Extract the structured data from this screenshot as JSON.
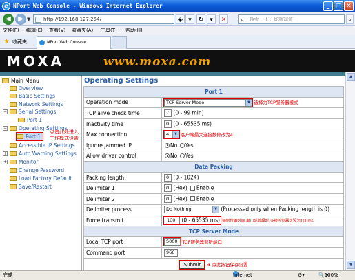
{
  "window": {
    "title": "NPort Web Console - Windows Internet Explorer",
    "buttons": [
      "_",
      "□",
      "✕"
    ]
  },
  "nav": {
    "address": "http://192.168.127.254/",
    "search_placeholder": "搜索一下，你就知道"
  },
  "menu": [
    "文件(F)",
    "编辑(E)",
    "查看(V)",
    "收藏夹(A)",
    "工具(T)",
    "帮助(H)"
  ],
  "favorites": {
    "label": "收藏夹",
    "tab_title": "NPort Web Console"
  },
  "banner": {
    "logo": "MOXA",
    "url": "www.moxa.com"
  },
  "tree": {
    "root": "Main Menu",
    "items": [
      "Overview",
      "Basic Settings",
      "Network Settings",
      "Serial Settings",
      "Port 1",
      "Operating Settings",
      "Port 1",
      "Accessible IP Settings",
      "Auto Warning Settings",
      "Monitor",
      "Change Password",
      "Load Factory Default",
      "Save/Restart"
    ],
    "annotation": [
      "点击此处进入",
      "工作模式设置"
    ]
  },
  "main": {
    "heading": "Operating Settings",
    "sections": {
      "port": "Port 1",
      "data_packing": "Data Packing",
      "tcp_server": "TCP Server Mode"
    },
    "rows": {
      "operation_mode": {
        "label": "Operation mode",
        "value": "TCP Server Mode",
        "note": "选择为TCP服务器模式"
      },
      "tcp_alive": {
        "label": "TCP alive check time",
        "value": "7",
        "hint": "(0 - 99 min)"
      },
      "inactivity": {
        "label": "Inactivity time",
        "value": "0",
        "hint": "(0 - 65535 ms)"
      },
      "max_connection": {
        "label": "Max connection",
        "value": "4",
        "note": "客户端最大连接数修改为4"
      },
      "ignore_jammed": {
        "label": "Ignore jammed IP",
        "opt_no": "No",
        "opt_yes": "Yes"
      },
      "allow_driver": {
        "label": "Allow driver control",
        "opt_no": "No",
        "opt_yes": "Yes"
      },
      "packing_length": {
        "label": "Packing length",
        "value": "0",
        "hint": "(0 - 1024)"
      },
      "delimiter1": {
        "label": "Delimiter 1",
        "value": "0",
        "hex": "(Hex)",
        "enable": "Enable"
      },
      "delimiter2": {
        "label": "Delimiter 2",
        "value": "0",
        "hex": "(Hex)",
        "enable": "Enable"
      },
      "delimiter_process": {
        "label": "Delimiter process",
        "value": "Do Nothing",
        "hint": "(Processed only when Packing length is 0)"
      },
      "force_transmit": {
        "label": "Force transmit",
        "value": "100",
        "hint": "(0 - 65535 ms)",
        "note": "强制传输时间,串口成帧超时,多接控制器可设为100ms"
      },
      "local_tcp_port": {
        "label": "Local TCP port",
        "value": "5000",
        "note": "TCP服务器监听端口"
      },
      "command_port": {
        "label": "Command port",
        "value": "966"
      }
    },
    "submit": {
      "label": "Submit",
      "note": "点此按钮保存设置"
    }
  },
  "status": {
    "left": "完成",
    "zone": "Internet",
    "zoom": "100%"
  }
}
